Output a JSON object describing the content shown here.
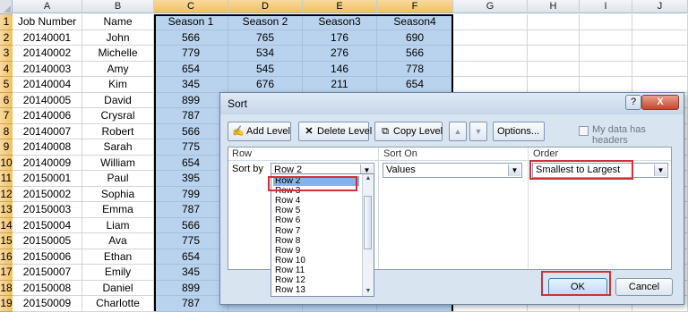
{
  "columns": [
    "A",
    "B",
    "C",
    "D",
    "E",
    "F",
    "G",
    "H",
    "I",
    "J"
  ],
  "rows": [
    [
      "1",
      "Job Number",
      "Name",
      "Season 1",
      "Season 2",
      "Season3",
      "Season4"
    ],
    [
      "2",
      "20140001",
      "John",
      "566",
      "765",
      "176",
      "690"
    ],
    [
      "3",
      "20140002",
      "Michelle",
      "779",
      "534",
      "276",
      "566"
    ],
    [
      "4",
      "20140003",
      "Amy",
      "654",
      "545",
      "146",
      "778"
    ],
    [
      "5",
      "20140004",
      "Kim",
      "345",
      "676",
      "211",
      "654"
    ],
    [
      "6",
      "20140005",
      "David",
      "899",
      "",
      "",
      ""
    ],
    [
      "7",
      "20140006",
      "Crysral",
      "787",
      "",
      "",
      ""
    ],
    [
      "8",
      "20140007",
      "Robert",
      "566",
      "",
      "",
      ""
    ],
    [
      "9",
      "20140008",
      "Sarah",
      "775",
      "",
      "",
      ""
    ],
    [
      "10",
      "20140009",
      "William",
      "654",
      "",
      "",
      ""
    ],
    [
      "11",
      "20150001",
      "Paul",
      "395",
      "",
      "",
      ""
    ],
    [
      "12",
      "20150002",
      "Sophia",
      "799",
      "",
      "",
      ""
    ],
    [
      "13",
      "20150003",
      "Emma",
      "787",
      "",
      "",
      ""
    ],
    [
      "14",
      "20150004",
      "Liam",
      "566",
      "",
      "",
      ""
    ],
    [
      "15",
      "20150005",
      "Ava",
      "775",
      "",
      "",
      ""
    ],
    [
      "16",
      "20150006",
      "Ethan",
      "654",
      "",
      "",
      ""
    ],
    [
      "17",
      "20150007",
      "Emily",
      "345",
      "",
      "",
      ""
    ],
    [
      "18",
      "20150008",
      "Daniel",
      "899",
      "",
      "",
      ""
    ],
    [
      "19",
      "20150009",
      "Charlotte",
      "787",
      "",
      "",
      ""
    ]
  ],
  "dialog": {
    "title": "Sort",
    "help_label": "?",
    "close_label": "X",
    "toolbar": {
      "add_level": "Add Level",
      "delete_level": "Delete Level",
      "copy_level": "Copy Level",
      "options": "Options...",
      "my_data_headers": "My data has headers"
    },
    "headers": {
      "row": "Row",
      "sort_on": "Sort On",
      "order": "Order"
    },
    "sort_by_label": "Sort by",
    "row_value": "Row 2",
    "sort_on_value": "Values",
    "order_value": "Smallest to Largest",
    "row_options": [
      "Row 2",
      "Row 3",
      "Row 4",
      "Row 5",
      "Row 6",
      "Row 7",
      "Row 8",
      "Row 9",
      "Row 10",
      "Row 11",
      "Row 12",
      "Row 13"
    ],
    "ok_label": "OK",
    "cancel_label": "Cancel"
  },
  "colors": {
    "selection": "#b9d3ee",
    "row_header": "#f1c15f",
    "highlight_box": "#d1303b"
  }
}
